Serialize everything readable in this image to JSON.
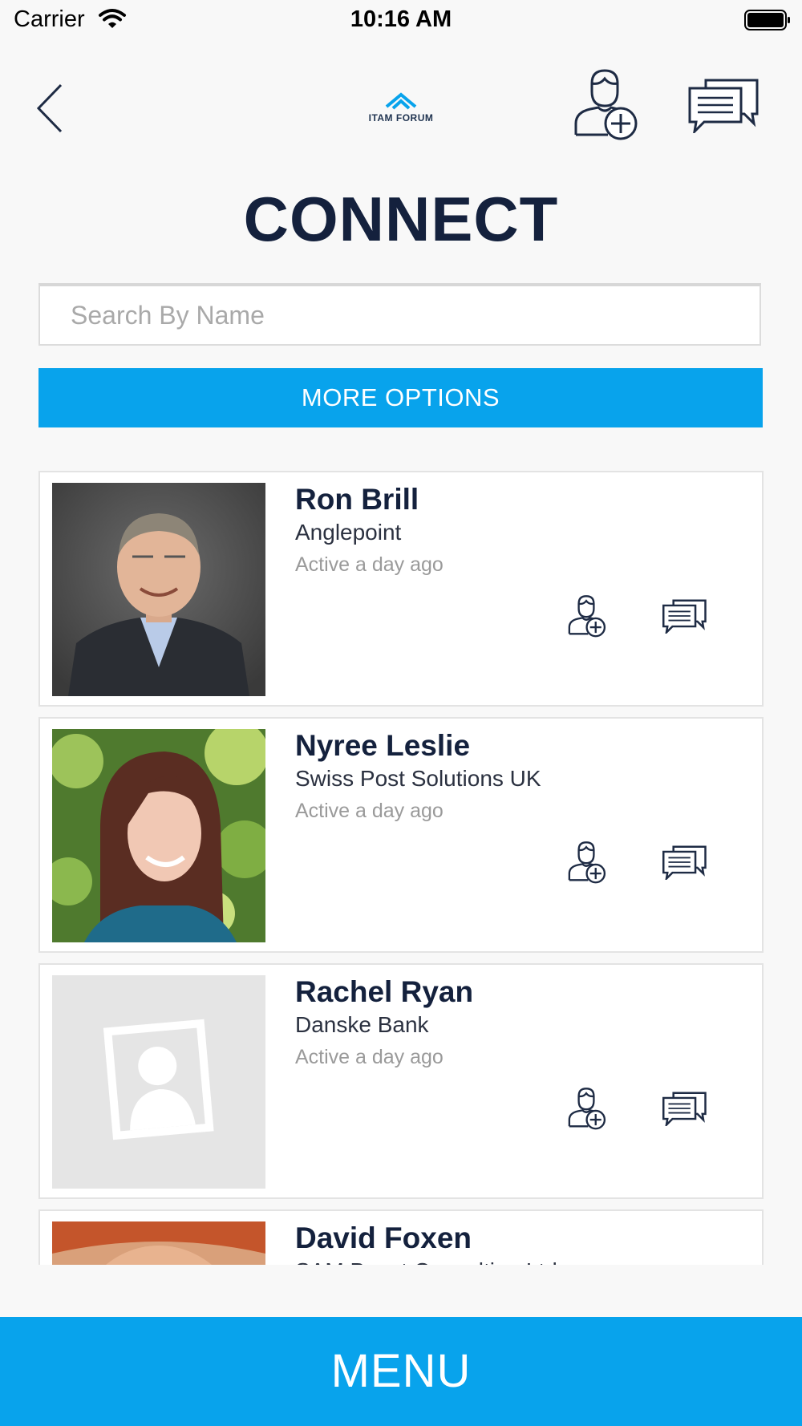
{
  "status_bar": {
    "carrier": "Carrier",
    "time": "10:16 AM"
  },
  "header": {
    "logo_text": "ITAM FORUM",
    "back_icon": "chevron-left-icon",
    "add_contact_icon": "user-add-icon",
    "messages_icon": "chat-bubbles-icon"
  },
  "page": {
    "title": "CONNECT"
  },
  "search": {
    "placeholder": "Search By Name",
    "value": ""
  },
  "more_options": {
    "label": "MORE OPTIONS"
  },
  "people": [
    {
      "name": "Ron Brill",
      "company": "Anglepoint",
      "activity": "Active a day ago",
      "photo": "photo-man-grey-suit"
    },
    {
      "name": "Nyree Leslie",
      "company": "Swiss Post Solutions UK",
      "activity": "Active a day ago",
      "photo": "photo-woman-long-hair"
    },
    {
      "name": "Rachel Ryan",
      "company": "Danske Bank",
      "activity": "Active a day ago",
      "photo": "placeholder-avatar"
    },
    {
      "name": "David Foxen",
      "company": "SAM Boost Consulting Ltd",
      "activity": "",
      "photo": "photo-man-red-hair"
    }
  ],
  "footer": {
    "menu_label": "MENU"
  },
  "colors": {
    "accent": "#08a3ec",
    "title": "#14213d",
    "muted": "#9a9a9a"
  }
}
